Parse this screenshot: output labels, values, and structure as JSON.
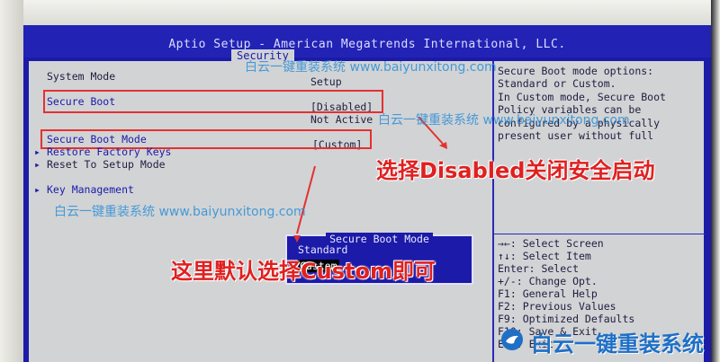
{
  "header": {
    "title": "Aptio Setup - American Megatrends International, LLC.",
    "active_tab": "Security"
  },
  "main": {
    "column_header": "Setup",
    "system_mode_label": "System Mode",
    "secure_boot_label": "Secure Boot",
    "secure_boot_value": "[Disabled]",
    "secure_boot_status": "Not Active",
    "secure_boot_mode_label": "Secure Boot Mode",
    "secure_boot_mode_value": "[Custom]",
    "restore_factory_keys": "Restore Factory Keys",
    "reset_setup_mode": "Reset To Setup Mode",
    "key_management": "Key Management"
  },
  "popup": {
    "title": "Secure Boot Mode",
    "options": [
      "Standard",
      "Custom"
    ],
    "selected": "Custom"
  },
  "help": {
    "lines": [
      "Secure Boot mode options:",
      "Standard or Custom.",
      "In Custom mode, Secure Boot",
      "Policy variables can be",
      "configured by a physically",
      "present user without full"
    ],
    "keys": [
      "→←: Select Screen",
      "↑↓: Select Item",
      "Enter: Select",
      "+/-: Change Opt.",
      "F1: General Help",
      "F2: Previous Values",
      "F9: Optimized Defaults",
      "F10: Save & Exit",
      "ESC: Exit"
    ]
  },
  "annotations": {
    "disabled_note": "选择Disabled关闭安全启动",
    "custom_note": "这里默认选择Custom即可"
  },
  "watermarks": {
    "text": "白云一键重装系统 www.baiyunxitong.com",
    "logo_text": "白云一键重装系统",
    "logo_url": "www.baiyunxitong.com"
  },
  "colors": {
    "bios_blue": "#1c1aa8",
    "panel_gray": "#d1d3d5",
    "highlight_red": "#e53030",
    "watermark_blue": "#2f8fd6"
  }
}
